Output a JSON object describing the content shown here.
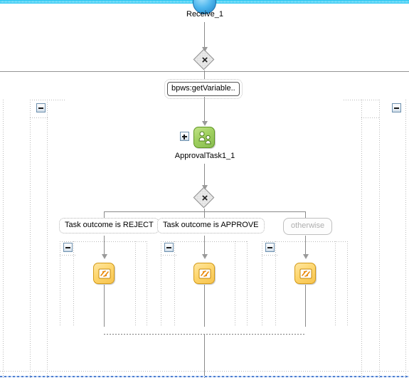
{
  "diagram": {
    "title": "BPEL Process Flow",
    "type": "bpel-process-flow"
  },
  "nodes": {
    "start": {
      "label": "Receive_1",
      "icon": "receive-circle-icon",
      "color": "#1b7fc4"
    },
    "switch_top": {
      "icon": "switch-diamond-icon",
      "glyph": "×"
    },
    "condition_expression": {
      "text": "bpws:getVariable.."
    },
    "human_task": {
      "label": "ApprovalTask1_1",
      "icon": "human-task-icon",
      "color": "#8cc63f",
      "toggle": "expand"
    },
    "switch_bottom": {
      "icon": "switch-diamond-icon",
      "glyph": "×"
    }
  },
  "branches": [
    {
      "label": "Task outcome is REJECT",
      "muted": false,
      "toggle": "collapse",
      "activity_icon": "assign-icon"
    },
    {
      "label": "Task outcome is APPROVE",
      "muted": false,
      "toggle": "collapse",
      "activity_icon": "assign-icon"
    },
    {
      "label": "otherwise",
      "muted": true,
      "toggle": "collapse",
      "activity_icon": "assign-icon"
    }
  ],
  "scopes": {
    "left_toggle": "collapse",
    "right_toggle": "collapse"
  },
  "colors": {
    "band": "#27c6f2",
    "task_green": "#8cc63f",
    "task_yellow": "#fdcd4e",
    "connector": "#8a8a8a",
    "muted_text": "#aeaeae"
  }
}
